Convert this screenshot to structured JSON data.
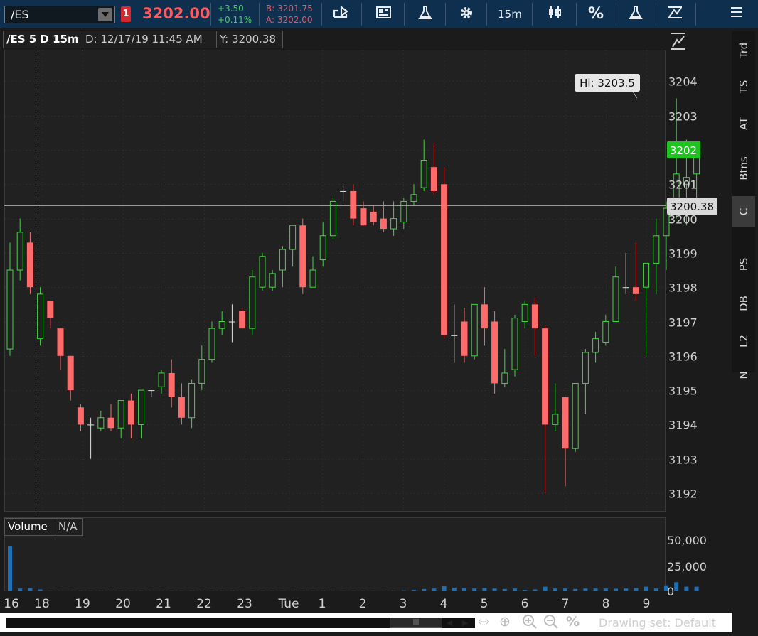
{
  "toolbar": {
    "symbol": "/ES",
    "alert_count": "1",
    "last_price": "3202.00",
    "change_abs": "+3.50",
    "change_pct": "+0.11%",
    "bid": "B: 3201.75",
    "ask": "A: 3202.00",
    "timeframe": "15m",
    "percent": "%"
  },
  "chart_header": {
    "title": "/ES 5 D 15m",
    "date_readout": "D: 12/17/19 11:45 AM",
    "y_readout": "Y: 3200.38"
  },
  "chart_labels": {
    "hi_label": "Hi: 3203.5",
    "current_price": "3202",
    "crosshair_price": "3200.38"
  },
  "volume_header": {
    "label": "Volume",
    "value": "N/A"
  },
  "right_tabs": [
    "Trd",
    "TS",
    "AT",
    "Btns",
    "C",
    "PS",
    "DB",
    "L2",
    "N"
  ],
  "active_tab": "C",
  "footer": {
    "drawing_set": "Drawing set: Default"
  },
  "colors": {
    "up": "#3dd83d",
    "down": "#ff6b6b",
    "volume": "#1f6fb5",
    "current_price_bg": "#1fc41f",
    "toolbar_bg": "#0f2f4f"
  },
  "chart_data": {
    "type": "candlestick",
    "y_ticks": [
      3192,
      3193,
      3194,
      3195,
      3196,
      3197,
      3198,
      3199,
      3200,
      3201,
      3202,
      3203,
      3204
    ],
    "ylim": [
      3191.7,
      3205.0
    ],
    "x_tick_labels": [
      "16",
      "18",
      "19",
      "20",
      "21",
      "22",
      "23",
      "Tue",
      "1",
      "2",
      "3",
      "4",
      "5",
      "6",
      "7",
      "8",
      "9"
    ],
    "volume_ticks": [
      "50,000",
      "25,000",
      "0"
    ],
    "volume_ylim": [
      0,
      55000
    ],
    "candles": [
      {
        "o": 3196.2,
        "h": 3199.3,
        "l": 3196.0,
        "c": 3198.5
      },
      {
        "o": 3198.5,
        "h": 3200.0,
        "l": 3198.2,
        "c": 3199.6
      },
      {
        "o": 3199.3,
        "h": 3199.6,
        "l": 3197.8,
        "c": 3198.0
      },
      {
        "o": 3196.5,
        "h": 3198.0,
        "l": 3196.3,
        "c": 3197.8
      },
      {
        "o": 3197.6,
        "h": 3197.6,
        "l": 3196.8,
        "c": 3197.1
      },
      {
        "o": 3196.8,
        "h": 3196.8,
        "l": 3195.6,
        "c": 3196.0
      },
      {
        "o": 3196.0,
        "h": 3196.0,
        "l": 3194.7,
        "c": 3195.0
      },
      {
        "o": 3194.5,
        "h": 3194.6,
        "l": 3193.8,
        "c": 3194.0
      },
      {
        "o": 3194.0,
        "h": 3194.2,
        "l": 3193.0,
        "c": 3194.0
      },
      {
        "o": 3193.9,
        "h": 3194.4,
        "l": 3193.8,
        "c": 3194.2
      },
      {
        "o": 3194.2,
        "h": 3194.6,
        "l": 3193.8,
        "c": 3193.9
      },
      {
        "o": 3193.9,
        "h": 3194.7,
        "l": 3193.6,
        "c": 3194.7
      },
      {
        "o": 3194.7,
        "h": 3194.9,
        "l": 3193.6,
        "c": 3194.0
      },
      {
        "o": 3194.0,
        "h": 3195.0,
        "l": 3193.6,
        "c": 3195.0
      },
      {
        "o": 3195.0,
        "h": 3195.0,
        "l": 3194.8,
        "c": 3195.0
      },
      {
        "o": 3195.1,
        "h": 3195.6,
        "l": 3194.9,
        "c": 3195.5
      },
      {
        "o": 3195.5,
        "h": 3195.9,
        "l": 3194.5,
        "c": 3194.8
      },
      {
        "o": 3194.8,
        "h": 3195.2,
        "l": 3194.0,
        "c": 3194.2
      },
      {
        "o": 3194.2,
        "h": 3195.3,
        "l": 3193.9,
        "c": 3195.2
      },
      {
        "o": 3195.2,
        "h": 3196.3,
        "l": 3195.0,
        "c": 3195.9
      },
      {
        "o": 3195.9,
        "h": 3197.0,
        "l": 3195.8,
        "c": 3196.8
      },
      {
        "o": 3196.8,
        "h": 3197.3,
        "l": 3196.6,
        "c": 3197.0
      },
      {
        "o": 3197.0,
        "h": 3197.5,
        "l": 3196.4,
        "c": 3197.0
      },
      {
        "o": 3197.3,
        "h": 3197.4,
        "l": 3196.8,
        "c": 3196.8
      },
      {
        "o": 3196.8,
        "h": 3198.5,
        "l": 3196.6,
        "c": 3198.3
      },
      {
        "o": 3198.0,
        "h": 3199.0,
        "l": 3197.9,
        "c": 3198.9
      },
      {
        "o": 3198.0,
        "h": 3198.5,
        "l": 3197.9,
        "c": 3198.4
      },
      {
        "o": 3198.5,
        "h": 3199.2,
        "l": 3198.0,
        "c": 3199.1
      },
      {
        "o": 3199.1,
        "h": 3199.8,
        "l": 3198.6,
        "c": 3199.8
      },
      {
        "o": 3199.8,
        "h": 3200.0,
        "l": 3197.8,
        "c": 3198.0
      },
      {
        "o": 3198.0,
        "h": 3198.9,
        "l": 3198.0,
        "c": 3198.5
      },
      {
        "o": 3198.8,
        "h": 3199.9,
        "l": 3198.6,
        "c": 3199.5
      },
      {
        "o": 3199.5,
        "h": 3200.6,
        "l": 3199.4,
        "c": 3200.5
      },
      {
        "o": 3200.8,
        "h": 3201.0,
        "l": 3200.5,
        "c": 3200.8
      },
      {
        "o": 3200.8,
        "h": 3201.0,
        "l": 3199.8,
        "c": 3200.0
      },
      {
        "o": 3200.3,
        "h": 3200.5,
        "l": 3199.8,
        "c": 3199.8
      },
      {
        "o": 3200.2,
        "h": 3200.4,
        "l": 3199.8,
        "c": 3199.9
      },
      {
        "o": 3200.0,
        "h": 3200.5,
        "l": 3199.6,
        "c": 3199.7
      },
      {
        "o": 3199.7,
        "h": 3200.5,
        "l": 3199.5,
        "c": 3200.0
      },
      {
        "o": 3199.9,
        "h": 3200.6,
        "l": 3199.7,
        "c": 3200.5
      },
      {
        "o": 3200.5,
        "h": 3201.0,
        "l": 3200.4,
        "c": 3200.7
      },
      {
        "o": 3200.9,
        "h": 3202.3,
        "l": 3200.8,
        "c": 3201.7
      },
      {
        "o": 3201.5,
        "h": 3202.2,
        "l": 3200.7,
        "c": 3200.8
      },
      {
        "o": 3201.0,
        "h": 3201.5,
        "l": 3196.5,
        "c": 3196.6
      },
      {
        "o": 3196.6,
        "h": 3197.5,
        "l": 3195.8,
        "c": 3196.6
      },
      {
        "o": 3197.0,
        "h": 3197.4,
        "l": 3195.8,
        "c": 3196.0
      },
      {
        "o": 3196.0,
        "h": 3197.5,
        "l": 3195.9,
        "c": 3197.5
      },
      {
        "o": 3197.5,
        "h": 3198.0,
        "l": 3196.3,
        "c": 3196.8
      },
      {
        "o": 3197.0,
        "h": 3197.3,
        "l": 3194.9,
        "c": 3195.2
      },
      {
        "o": 3195.2,
        "h": 3196.2,
        "l": 3195.1,
        "c": 3195.5
      },
      {
        "o": 3195.6,
        "h": 3197.2,
        "l": 3195.4,
        "c": 3197.1
      },
      {
        "o": 3197.0,
        "h": 3197.6,
        "l": 3196.8,
        "c": 3197.5
      },
      {
        "o": 3197.5,
        "h": 3197.7,
        "l": 3196.0,
        "c": 3196.8
      },
      {
        "o": 3196.8,
        "h": 3196.9,
        "l": 3192.0,
        "c": 3194.0
      },
      {
        "o": 3194.0,
        "h": 3195.2,
        "l": 3193.8,
        "c": 3194.3
      },
      {
        "o": 3194.8,
        "h": 3194.8,
        "l": 3192.2,
        "c": 3193.3
      },
      {
        "o": 3193.3,
        "h": 3195.2,
        "l": 3193.2,
        "c": 3195.2
      },
      {
        "o": 3195.2,
        "h": 3196.2,
        "l": 3194.3,
        "c": 3196.1
      },
      {
        "o": 3196.1,
        "h": 3196.7,
        "l": 3195.8,
        "c": 3196.5
      },
      {
        "o": 3196.4,
        "h": 3197.2,
        "l": 3196.3,
        "c": 3197.0
      },
      {
        "o": 3197.0,
        "h": 3198.6,
        "l": 3197.0,
        "c": 3198.3
      },
      {
        "o": 3198.0,
        "h": 3199.0,
        "l": 3197.8,
        "c": 3198.0
      },
      {
        "o": 3198.0,
        "h": 3199.3,
        "l": 3197.6,
        "c": 3197.8
      },
      {
        "o": 3198.0,
        "h": 3198.7,
        "l": 3196.0,
        "c": 3198.7
      },
      {
        "o": 3198.7,
        "h": 3200.0,
        "l": 3197.8,
        "c": 3199.5
      },
      {
        "o": 3199.5,
        "h": 3200.5,
        "l": 3198.5,
        "c": 3200.3
      },
      {
        "o": 3200.3,
        "h": 3203.5,
        "l": 3200.0,
        "c": 3201.3
      },
      {
        "o": 3201.0,
        "h": 3202.3,
        "l": 3199.8,
        "c": 3201.2
      },
      {
        "o": 3201.3,
        "h": 3202.2,
        "l": 3200.5,
        "c": 3202.0
      }
    ],
    "volumes": [
      50000,
      3000,
      3500,
      2000,
      500,
      400,
      500,
      800,
      400,
      300,
      400,
      300,
      500,
      300,
      400,
      500,
      300,
      400,
      700,
      500,
      400,
      600,
      300,
      400,
      300,
      400,
      400,
      400,
      500,
      500,
      400,
      300,
      600,
      400,
      300,
      300,
      300,
      300,
      300,
      1000,
      1500,
      2500,
      3000,
      5500,
      4000,
      3500,
      3000,
      3500,
      3000,
      2500,
      3000,
      1500,
      2000,
      5000,
      3000,
      3000,
      2500,
      3000,
      3000,
      3000,
      2800,
      3000,
      3500,
      5000,
      3000,
      6500,
      10000,
      5000,
      5000
    ]
  }
}
